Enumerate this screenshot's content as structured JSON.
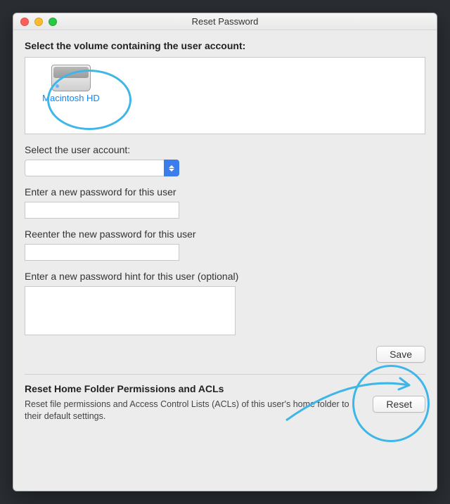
{
  "window": {
    "title": "Reset Password"
  },
  "volume": {
    "section_label": "Select the volume containing the user account:",
    "items": [
      {
        "name": "Macintosh HD"
      }
    ]
  },
  "user_select": {
    "label": "Select the user account:",
    "value": ""
  },
  "password": {
    "new_label": "Enter a new password for this user",
    "new_value": "",
    "reenter_label": "Reenter the new password for this user",
    "reenter_value": "",
    "hint_label": "Enter a new password hint for this user (optional)",
    "hint_value": ""
  },
  "buttons": {
    "save": "Save",
    "reset": "Reset"
  },
  "acl": {
    "title": "Reset Home Folder Permissions and ACLs",
    "description": "Reset file permissions and Access Control Lists (ACLs) of this user's home folder to their default settings."
  },
  "annotation": {
    "color": "#3fb6e8"
  }
}
